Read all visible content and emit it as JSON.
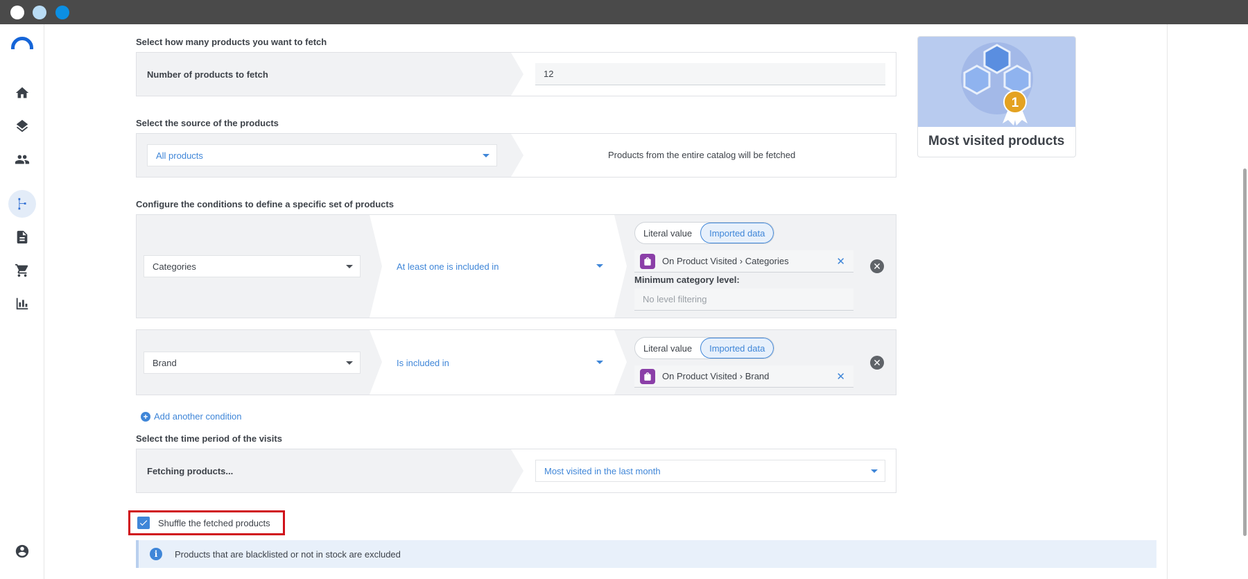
{
  "window": {
    "buttons": [
      "close",
      "minimize",
      "maximize"
    ]
  },
  "sidebar": {
    "logo": "brand-logo",
    "items": [
      {
        "name": "home",
        "icon": "home-icon"
      },
      {
        "name": "layers",
        "icon": "layers-icon"
      },
      {
        "name": "people",
        "icon": "people-icon"
      },
      {
        "name": "flow",
        "icon": "flow-icon",
        "active": true
      },
      {
        "name": "document",
        "icon": "document-icon"
      },
      {
        "name": "cart",
        "icon": "cart-icon"
      },
      {
        "name": "analytics",
        "icon": "bar-chart-icon"
      },
      {
        "name": "account",
        "icon": "account-circle-icon"
      }
    ]
  },
  "fetch_count": {
    "section_label": "Select how many products you want to fetch",
    "field_label": "Number of products to fetch",
    "value": "12"
  },
  "source": {
    "section_label": "Select the source of the products",
    "selected": "All products",
    "description": "Products from the entire catalog will be fetched"
  },
  "conditions": {
    "section_label": "Configure the conditions to define a specific set of products",
    "rows": [
      {
        "field": "Categories",
        "operator": "At least one is included in",
        "toggle_literal": "Literal value",
        "toggle_imported": "Imported data",
        "chip": "On Product Visited › Categories",
        "extra_label": "Minimum category level:",
        "extra_placeholder": "No level filtering"
      },
      {
        "field": "Brand",
        "operator": "Is included in",
        "toggle_literal": "Literal value",
        "toggle_imported": "Imported data",
        "chip": "On Product Visited › Brand"
      }
    ],
    "add_label": "Add another condition"
  },
  "time_period": {
    "section_label": "Select the time period of the visits",
    "field_label": "Fetching products...",
    "selected": "Most visited in the last month"
  },
  "shuffle": {
    "label": "Shuffle the fetched products",
    "checked": true
  },
  "info": {
    "text": "Products that are blacklisted or not in stock are excluded"
  },
  "card": {
    "title": "Most visited products",
    "badge": "1"
  },
  "colors": {
    "accent": "#3f86d8",
    "highlight": "#d0121b",
    "card_bg": "#b8cbef"
  }
}
